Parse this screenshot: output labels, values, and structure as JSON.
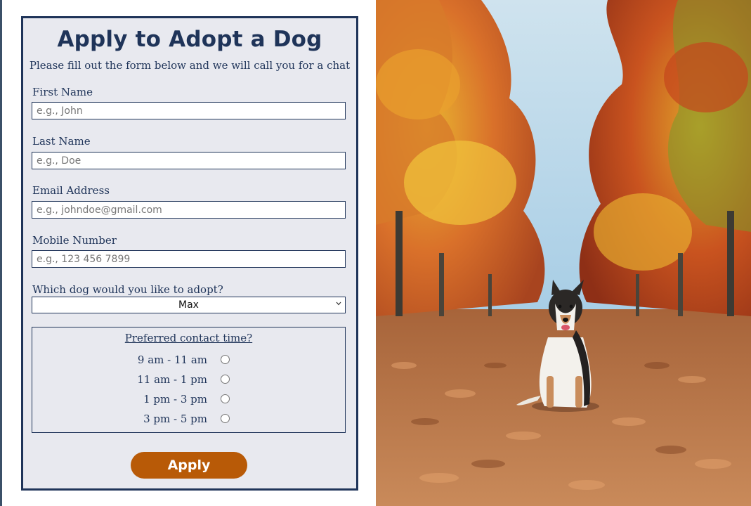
{
  "form": {
    "title": "Apply to Adopt a Dog",
    "subtitle": "Please fill out the form below and we will call you for a chat",
    "fields": [
      {
        "label": "First Name",
        "placeholder": "e.g., John"
      },
      {
        "label": "Last Name",
        "placeholder": "e.g., Doe"
      },
      {
        "label": "Email Address",
        "placeholder": "e.g., johndoe@gmail.com"
      },
      {
        "label": "Mobile Number",
        "placeholder": "e.g., 123 456 7899"
      }
    ],
    "dog_select": {
      "label": "Which dog would you like to adopt?",
      "selected": "Max"
    },
    "contact_time": {
      "legend": "Preferred contact time?",
      "options": [
        "9 am - 11 am",
        "11 am - 1 pm",
        "1 pm - 3 pm",
        "3 pm - 5 pm"
      ]
    },
    "apply_label": "Apply"
  },
  "colors": {
    "primary": "#1f3459",
    "form_background": "#e8e9ef",
    "button": "#b85a07"
  },
  "icons": {
    "select_caret": "chevron-down-icon"
  }
}
